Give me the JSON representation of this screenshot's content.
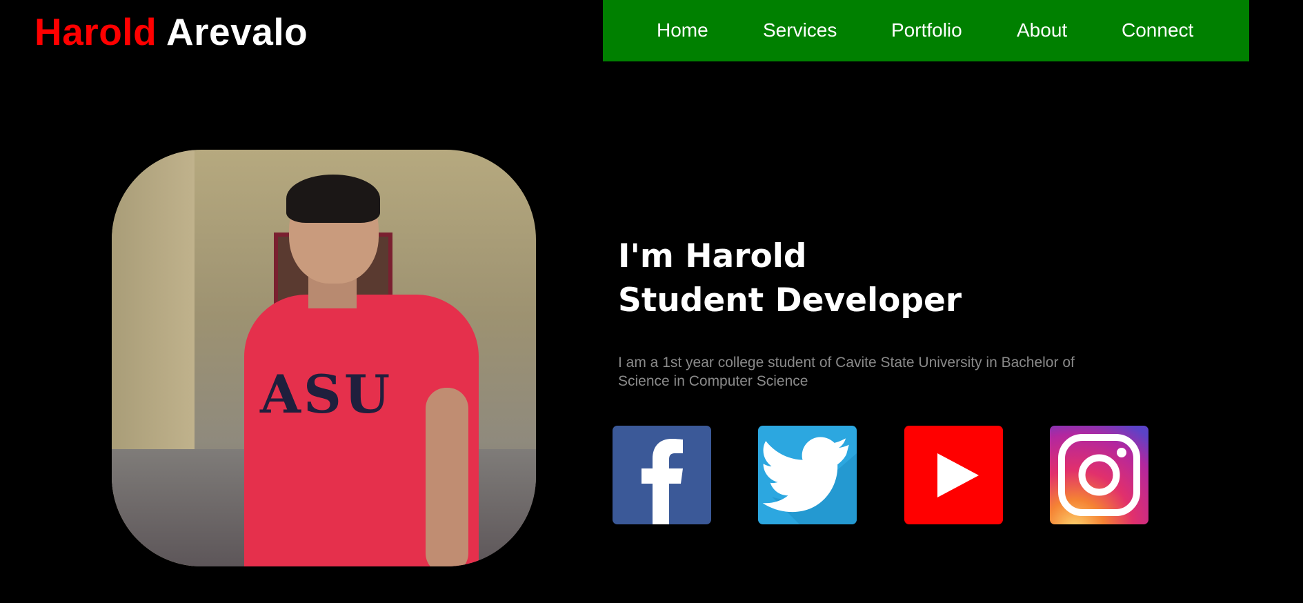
{
  "brand": {
    "first": "Harold",
    "last": "Arevalo"
  },
  "nav": {
    "items": [
      {
        "label": "Home"
      },
      {
        "label": "Services"
      },
      {
        "label": "Portfolio"
      },
      {
        "label": "About"
      },
      {
        "label": "Connect"
      }
    ]
  },
  "hero": {
    "line1": "I'm Harold",
    "line2": "Student Developer",
    "bio": "I am a 1st year college student of Cavite State University in Bachelor of Science in Computer Science",
    "photo_shirt_text": "ASU"
  },
  "socials": [
    {
      "icon": "facebook-icon",
      "color": "#3b5998"
    },
    {
      "icon": "twitter-icon",
      "color": "#2ca7e0"
    },
    {
      "icon": "youtube-icon",
      "color": "#ff0000"
    },
    {
      "icon": "instagram-icon",
      "color": "#e1306c"
    }
  ],
  "colors": {
    "nav_bg": "#008000",
    "accent": "#ff0000",
    "bg": "#000000"
  }
}
